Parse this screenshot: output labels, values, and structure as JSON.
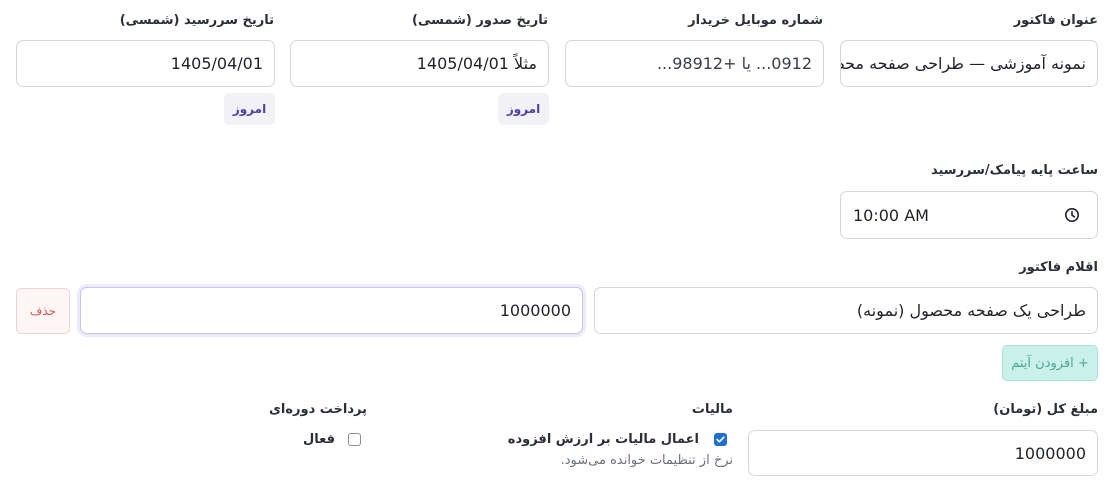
{
  "invoice_title": {
    "label": "عنوان فاکتور",
    "value": "نمونه آموزشی — طراحی صفحه محصو"
  },
  "buyer_mobile": {
    "label": "شماره موبایل خریدار",
    "placeholder": "0912... یا +98912..."
  },
  "issue_date": {
    "label": "تاریخ صدور (شمسی)",
    "value": "مثلاً 1405/04/01",
    "today_label": "امروز"
  },
  "due_date": {
    "label": "تاریخ سررسید (شمسی)",
    "value": "1405/04/01",
    "today_label": "امروز"
  },
  "sms_time": {
    "label": "ساعت پایه پیامک/سررسید",
    "value": "10:00 AM",
    "icon": "clock-icon"
  },
  "items": {
    "label": "اقلام فاکتور",
    "rows": [
      {
        "description": "طراحی یک صفحه محصول (نمونه)",
        "price": "1000000",
        "delete_label": "حذف"
      }
    ],
    "add_label": "+ افزودن آیتم"
  },
  "total": {
    "label": "مبلغ کل (تومان)",
    "value": "1000000"
  },
  "tax": {
    "label": "مالیات",
    "vat_label": "اعمال مالیات بر ارزش افزوده",
    "vat_checked": true,
    "hint": "نرخ از تنظیمات خوانده می‌شود."
  },
  "recurring": {
    "label": "پرداخت دوره‌ای",
    "active_label": "فعال",
    "active_checked": false
  },
  "colors": {
    "accent": "#4b3fa8",
    "checkbox": "#1f6fd1",
    "delete": "#d9534f",
    "add": "#4fa595"
  }
}
